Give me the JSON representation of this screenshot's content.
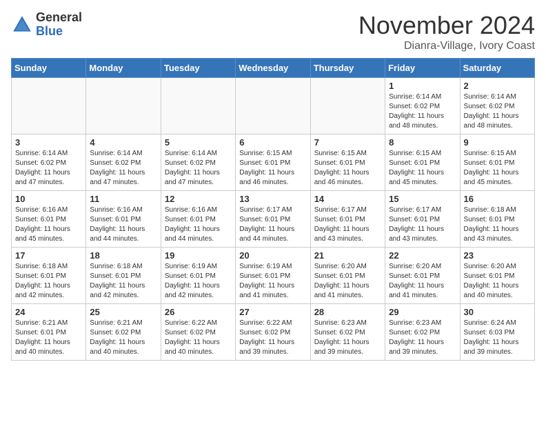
{
  "header": {
    "logo_general": "General",
    "logo_blue": "Blue",
    "month": "November 2024",
    "location": "Dianra-Village, Ivory Coast"
  },
  "days_of_week": [
    "Sunday",
    "Monday",
    "Tuesday",
    "Wednesday",
    "Thursday",
    "Friday",
    "Saturday"
  ],
  "weeks": [
    [
      {
        "day": "",
        "empty": true
      },
      {
        "day": "",
        "empty": true
      },
      {
        "day": "",
        "empty": true
      },
      {
        "day": "",
        "empty": true
      },
      {
        "day": "",
        "empty": true
      },
      {
        "day": "1",
        "sunrise": "Sunrise: 6:14 AM",
        "sunset": "Sunset: 6:02 PM",
        "daylight": "Daylight: 11 hours and 48 minutes."
      },
      {
        "day": "2",
        "sunrise": "Sunrise: 6:14 AM",
        "sunset": "Sunset: 6:02 PM",
        "daylight": "Daylight: 11 hours and 48 minutes."
      }
    ],
    [
      {
        "day": "3",
        "sunrise": "Sunrise: 6:14 AM",
        "sunset": "Sunset: 6:02 PM",
        "daylight": "Daylight: 11 hours and 47 minutes."
      },
      {
        "day": "4",
        "sunrise": "Sunrise: 6:14 AM",
        "sunset": "Sunset: 6:02 PM",
        "daylight": "Daylight: 11 hours and 47 minutes."
      },
      {
        "day": "5",
        "sunrise": "Sunrise: 6:14 AM",
        "sunset": "Sunset: 6:02 PM",
        "daylight": "Daylight: 11 hours and 47 minutes."
      },
      {
        "day": "6",
        "sunrise": "Sunrise: 6:15 AM",
        "sunset": "Sunset: 6:01 PM",
        "daylight": "Daylight: 11 hours and 46 minutes."
      },
      {
        "day": "7",
        "sunrise": "Sunrise: 6:15 AM",
        "sunset": "Sunset: 6:01 PM",
        "daylight": "Daylight: 11 hours and 46 minutes."
      },
      {
        "day": "8",
        "sunrise": "Sunrise: 6:15 AM",
        "sunset": "Sunset: 6:01 PM",
        "daylight": "Daylight: 11 hours and 45 minutes."
      },
      {
        "day": "9",
        "sunrise": "Sunrise: 6:15 AM",
        "sunset": "Sunset: 6:01 PM",
        "daylight": "Daylight: 11 hours and 45 minutes."
      }
    ],
    [
      {
        "day": "10",
        "sunrise": "Sunrise: 6:16 AM",
        "sunset": "Sunset: 6:01 PM",
        "daylight": "Daylight: 11 hours and 45 minutes."
      },
      {
        "day": "11",
        "sunrise": "Sunrise: 6:16 AM",
        "sunset": "Sunset: 6:01 PM",
        "daylight": "Daylight: 11 hours and 44 minutes."
      },
      {
        "day": "12",
        "sunrise": "Sunrise: 6:16 AM",
        "sunset": "Sunset: 6:01 PM",
        "daylight": "Daylight: 11 hours and 44 minutes."
      },
      {
        "day": "13",
        "sunrise": "Sunrise: 6:17 AM",
        "sunset": "Sunset: 6:01 PM",
        "daylight": "Daylight: 11 hours and 44 minutes."
      },
      {
        "day": "14",
        "sunrise": "Sunrise: 6:17 AM",
        "sunset": "Sunset: 6:01 PM",
        "daylight": "Daylight: 11 hours and 43 minutes."
      },
      {
        "day": "15",
        "sunrise": "Sunrise: 6:17 AM",
        "sunset": "Sunset: 6:01 PM",
        "daylight": "Daylight: 11 hours and 43 minutes."
      },
      {
        "day": "16",
        "sunrise": "Sunrise: 6:18 AM",
        "sunset": "Sunset: 6:01 PM",
        "daylight": "Daylight: 11 hours and 43 minutes."
      }
    ],
    [
      {
        "day": "17",
        "sunrise": "Sunrise: 6:18 AM",
        "sunset": "Sunset: 6:01 PM",
        "daylight": "Daylight: 11 hours and 42 minutes."
      },
      {
        "day": "18",
        "sunrise": "Sunrise: 6:18 AM",
        "sunset": "Sunset: 6:01 PM",
        "daylight": "Daylight: 11 hours and 42 minutes."
      },
      {
        "day": "19",
        "sunrise": "Sunrise: 6:19 AM",
        "sunset": "Sunset: 6:01 PM",
        "daylight": "Daylight: 11 hours and 42 minutes."
      },
      {
        "day": "20",
        "sunrise": "Sunrise: 6:19 AM",
        "sunset": "Sunset: 6:01 PM",
        "daylight": "Daylight: 11 hours and 41 minutes."
      },
      {
        "day": "21",
        "sunrise": "Sunrise: 6:20 AM",
        "sunset": "Sunset: 6:01 PM",
        "daylight": "Daylight: 11 hours and 41 minutes."
      },
      {
        "day": "22",
        "sunrise": "Sunrise: 6:20 AM",
        "sunset": "Sunset: 6:01 PM",
        "daylight": "Daylight: 11 hours and 41 minutes."
      },
      {
        "day": "23",
        "sunrise": "Sunrise: 6:20 AM",
        "sunset": "Sunset: 6:01 PM",
        "daylight": "Daylight: 11 hours and 40 minutes."
      }
    ],
    [
      {
        "day": "24",
        "sunrise": "Sunrise: 6:21 AM",
        "sunset": "Sunset: 6:01 PM",
        "daylight": "Daylight: 11 hours and 40 minutes."
      },
      {
        "day": "25",
        "sunrise": "Sunrise: 6:21 AM",
        "sunset": "Sunset: 6:02 PM",
        "daylight": "Daylight: 11 hours and 40 minutes."
      },
      {
        "day": "26",
        "sunrise": "Sunrise: 6:22 AM",
        "sunset": "Sunset: 6:02 PM",
        "daylight": "Daylight: 11 hours and 40 minutes."
      },
      {
        "day": "27",
        "sunrise": "Sunrise: 6:22 AM",
        "sunset": "Sunset: 6:02 PM",
        "daylight": "Daylight: 11 hours and 39 minutes."
      },
      {
        "day": "28",
        "sunrise": "Sunrise: 6:23 AM",
        "sunset": "Sunset: 6:02 PM",
        "daylight": "Daylight: 11 hours and 39 minutes."
      },
      {
        "day": "29",
        "sunrise": "Sunrise: 6:23 AM",
        "sunset": "Sunset: 6:02 PM",
        "daylight": "Daylight: 11 hours and 39 minutes."
      },
      {
        "day": "30",
        "sunrise": "Sunrise: 6:24 AM",
        "sunset": "Sunset: 6:03 PM",
        "daylight": "Daylight: 11 hours and 39 minutes."
      }
    ]
  ]
}
